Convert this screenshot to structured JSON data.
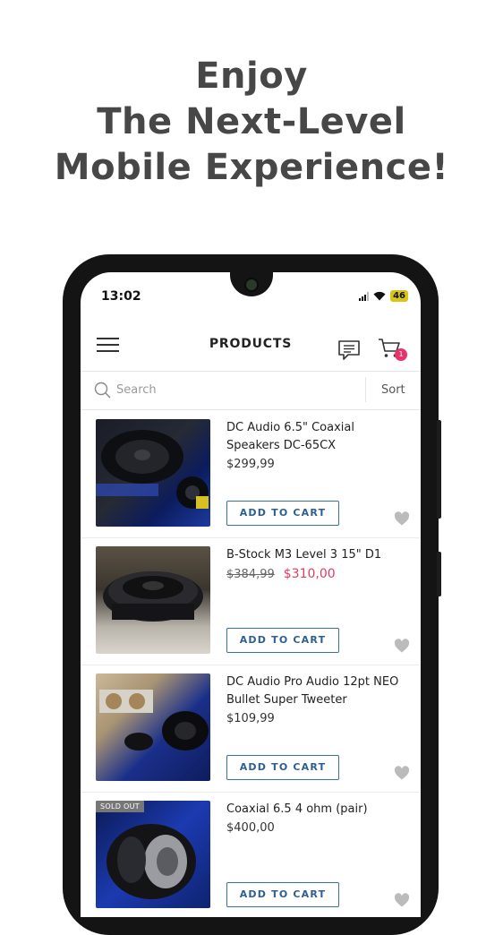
{
  "headline": {
    "line1": "Enjoy",
    "line2": "The Next-Level",
    "line3": "Mobile Experience!"
  },
  "status_bar": {
    "time": "13:02",
    "battery": "46",
    "icons": [
      "signal-icon",
      "wifi-icon",
      "battery-icon"
    ]
  },
  "app_bar": {
    "title": "PRODUCTS",
    "cart_count": "1",
    "icons": [
      "menu-icon",
      "chat-icon",
      "cart-icon"
    ]
  },
  "search": {
    "placeholder": "Search",
    "sort_label": "Sort"
  },
  "products": [
    {
      "name": "DC Audio 6.5\" Coaxial Speakers DC-65CX",
      "price": "$299,99",
      "old_price": "",
      "button": "ADD TO CART",
      "badge": ""
    },
    {
      "name": "B-Stock M3 Level 3 15\" D1",
      "price": "$310,00",
      "old_price": "$384,99",
      "button": "ADD TO CART",
      "badge": ""
    },
    {
      "name": "DC Audio Pro Audio 12pt NEO Bullet Super Tweeter",
      "price": "$109,99",
      "old_price": "",
      "button": "ADD TO CART",
      "badge": ""
    },
    {
      "name": "Coaxial 6.5 4 ohm (pair)",
      "price": "$400,00",
      "old_price": "",
      "button": "ADD TO CART",
      "badge": "SOLD OUT"
    }
  ],
  "colors": {
    "accent_blue": "#2e5f93",
    "sale_pink": "#e03a68",
    "badge_pink": "#e83269"
  }
}
